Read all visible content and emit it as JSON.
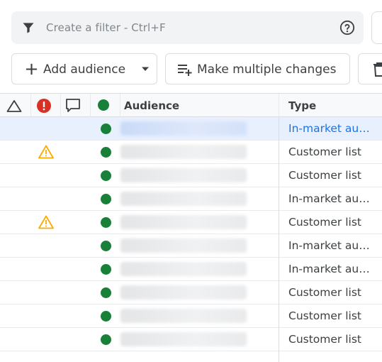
{
  "filter": {
    "placeholder": "Create a filter - Ctrl+F",
    "icons": {
      "filter": "filter-funnel-icon",
      "help": "help-circle-icon"
    }
  },
  "toolbar": {
    "add_audience_label": "Add audience",
    "make_changes_label": "Make multiple changes",
    "icons": {
      "add": "plus-icon",
      "dropdown": "caret-down-icon",
      "multi": "playlist-add-icon",
      "delete": "trash-icon"
    }
  },
  "table": {
    "headers": {
      "alerts": "alert-triangle-icon",
      "errors": "error-circle-icon",
      "comments": "comment-icon",
      "status": "status-dot-icon",
      "audience": "Audience",
      "type": "Type"
    },
    "rows": [
      {
        "warning": false,
        "status": "enabled",
        "type": "In-market audi…",
        "selected": true
      },
      {
        "warning": true,
        "status": "enabled",
        "type": "Customer list",
        "selected": false
      },
      {
        "warning": false,
        "status": "enabled",
        "type": "Customer list",
        "selected": false
      },
      {
        "warning": false,
        "status": "enabled",
        "type": "In-market audi…",
        "selected": false
      },
      {
        "warning": true,
        "status": "enabled",
        "type": "Customer list",
        "selected": false
      },
      {
        "warning": false,
        "status": "enabled",
        "type": "In-market audi…",
        "selected": false
      },
      {
        "warning": false,
        "status": "enabled",
        "type": "In-market audi…",
        "selected": false
      },
      {
        "warning": false,
        "status": "enabled",
        "type": "Customer list",
        "selected": false
      },
      {
        "warning": false,
        "status": "enabled",
        "type": "Customer list",
        "selected": false
      },
      {
        "warning": false,
        "status": "enabled",
        "type": "Customer list",
        "selected": false
      }
    ]
  },
  "colors": {
    "status_green": "#188038",
    "warning_yellow": "#f9ab00",
    "error_red": "#d93025",
    "selected_row": "#e8f0fe",
    "link_blue": "#1a73e8"
  }
}
